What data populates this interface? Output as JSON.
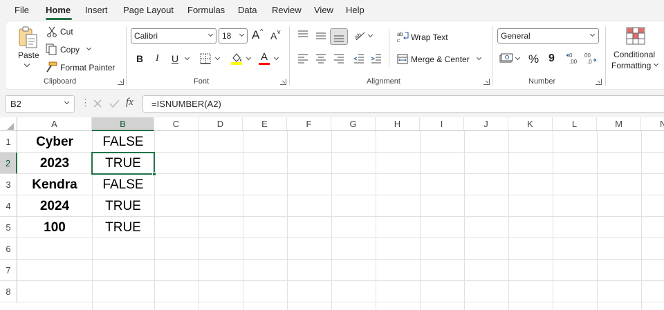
{
  "menu": {
    "tabs": [
      "File",
      "Home",
      "Insert",
      "Page Layout",
      "Formulas",
      "Data",
      "Review",
      "View",
      "Help"
    ],
    "active": "Home"
  },
  "ribbon": {
    "clipboard": {
      "paste": "Paste",
      "cut": "Cut",
      "copy": "Copy",
      "format_painter": "Format Painter",
      "label": "Clipboard"
    },
    "font": {
      "name": "Calibri",
      "size": "18",
      "grow": "A",
      "shrink": "A",
      "bold": "B",
      "italic": "I",
      "underline": "U",
      "font_color_letter": "A",
      "label": "Font",
      "highlight_color": "#ffff00",
      "font_color": "#ff0000"
    },
    "alignment": {
      "wrap_text": "Wrap Text",
      "merge_center": "Merge & Center",
      "label": "Alignment"
    },
    "number": {
      "format": "General",
      "percent": "%",
      "comma": "9",
      "label": "Number"
    },
    "styles": {
      "conditional_line1": "Conditional",
      "conditional_line2": "Formatting"
    }
  },
  "formula_bar": {
    "name_box": "B2",
    "fx": "fx",
    "formula": "=ISNUMBER(A2)"
  },
  "sheet": {
    "columns": [
      "A",
      "B",
      "C",
      "D",
      "E",
      "F",
      "G",
      "H",
      "I",
      "J",
      "K",
      "L",
      "M",
      "N"
    ],
    "rows": [
      "1",
      "2",
      "3",
      "4",
      "5",
      "6",
      "7",
      "8"
    ],
    "selected_cell": "B2",
    "cells": {
      "A1": "Cyber",
      "B1": "FALSE",
      "A2": "2023",
      "B2": "TRUE",
      "A3": "Kendra",
      "B3": "FALSE",
      "A4": "2024",
      "B4": "TRUE",
      "A5": "100",
      "B5": "TRUE"
    },
    "accent_color": "#217346"
  }
}
